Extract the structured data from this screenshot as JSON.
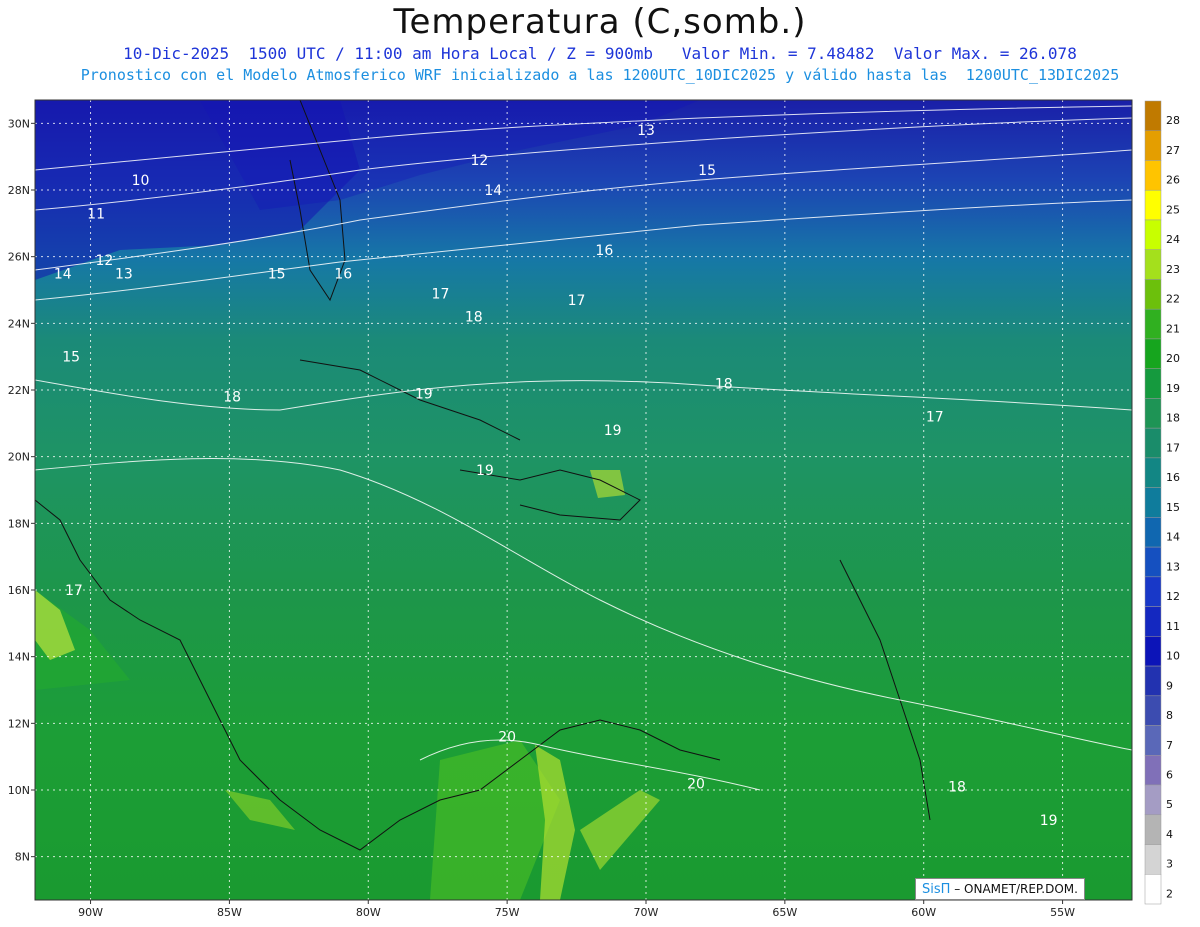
{
  "header": {
    "title": "Temperatura (C,somb.)",
    "subtitle_1": "10-Dic-2025  1500 UTC / 11:00 am Hora Local / Z = 900mb   Valor Min. = 7.48482  Valor Max. = 26.078",
    "subtitle_2": "Pronostico con el Modelo Atmosferico WRF inicializado a las 1200UTC_10DIC2025 y válido hasta las  1200UTC_13DIC2025"
  },
  "map": {
    "lat_labels": [
      "30N",
      "28N",
      "26N",
      "24N",
      "22N",
      "20N",
      "18N",
      "16N",
      "14N",
      "12N",
      "10N",
      "8N"
    ],
    "lon_labels": [
      "90W",
      "85W",
      "80W",
      "75W",
      "70W",
      "65W",
      "60W",
      "55W"
    ],
    "contour_labels": [
      "10",
      "11",
      "12",
      "13",
      "14",
      "15",
      "16",
      "17",
      "18",
      "19",
      "20"
    ],
    "contour_label_marks": [
      {
        "text": "13",
        "lon": -70.0,
        "lat": 29.8
      },
      {
        "text": "12",
        "lon": -76.0,
        "lat": 28.9
      },
      {
        "text": "15",
        "lon": -67.8,
        "lat": 28.6
      },
      {
        "text": "10",
        "lon": -88.2,
        "lat": 28.3
      },
      {
        "text": "14",
        "lon": -75.5,
        "lat": 28.0
      },
      {
        "text": "11",
        "lon": -89.8,
        "lat": 27.3
      },
      {
        "text": "16",
        "lon": -71.5,
        "lat": 26.2
      },
      {
        "text": "12",
        "lon": -89.5,
        "lat": 25.9
      },
      {
        "text": "13",
        "lon": -88.8,
        "lat": 25.5
      },
      {
        "text": "14",
        "lon": -91.0,
        "lat": 25.5
      },
      {
        "text": "15",
        "lon": -83.3,
        "lat": 25.5
      },
      {
        "text": "16",
        "lon": -80.9,
        "lat": 25.5
      },
      {
        "text": "17",
        "lon": -77.4,
        "lat": 24.9
      },
      {
        "text": "17",
        "lon": -72.5,
        "lat": 24.7
      },
      {
        "text": "18",
        "lon": -76.2,
        "lat": 24.2
      },
      {
        "text": "15",
        "lon": -90.7,
        "lat": 23.0
      },
      {
        "text": "18",
        "lon": -67.2,
        "lat": 22.2
      },
      {
        "text": "19",
        "lon": -78.0,
        "lat": 21.9
      },
      {
        "text": "18",
        "lon": -84.9,
        "lat": 21.8
      },
      {
        "text": "17",
        "lon": -59.6,
        "lat": 21.2
      },
      {
        "text": "19",
        "lon": -71.2,
        "lat": 20.8
      },
      {
        "text": "19",
        "lon": -75.8,
        "lat": 19.6
      },
      {
        "text": "17",
        "lon": -90.6,
        "lat": 16.0
      },
      {
        "text": "20",
        "lon": -75.0,
        "lat": 11.6
      },
      {
        "text": "20",
        "lon": -68.2,
        "lat": 10.2
      },
      {
        "text": "18",
        "lon": -58.8,
        "lat": 10.1
      },
      {
        "text": "19",
        "lon": -55.5,
        "lat": 9.1
      }
    ],
    "axis_range": {
      "lon": [
        -92,
        -52.5
      ],
      "lat": [
        6.7,
        30.7
      ]
    },
    "grid": "dotted",
    "colorbar": {
      "labels": [
        "28",
        "27",
        "26",
        "25",
        "24",
        "23",
        "22",
        "21",
        "20",
        "19",
        "18",
        "17",
        "16",
        "15",
        "14",
        "13",
        "12",
        "11",
        "10",
        "9",
        "8",
        "7",
        "6",
        "5",
        "4",
        "3",
        "2"
      ],
      "colors": [
        "#c07a00",
        "#e49e00",
        "#ffc400",
        "#ffff00",
        "#c8ff00",
        "#a4e01c",
        "#6cc00c",
        "#30b020",
        "#16a51e",
        "#159a3e",
        "#1e9455",
        "#1a8c6a",
        "#128684",
        "#0f7c9c",
        "#1067b0",
        "#1550c0",
        "#1838c8",
        "#1428c0",
        "#0c14b8",
        "#2232b0",
        "#3c4cb0",
        "#5a68b8",
        "#8070b8",
        "#a49cc4",
        "#b4b4b4",
        "#d4d4d4",
        "#ffffff"
      ]
    }
  },
  "credit": {
    "brand": "SisΠ",
    "text": " – ONAMET/REP.DOM."
  }
}
